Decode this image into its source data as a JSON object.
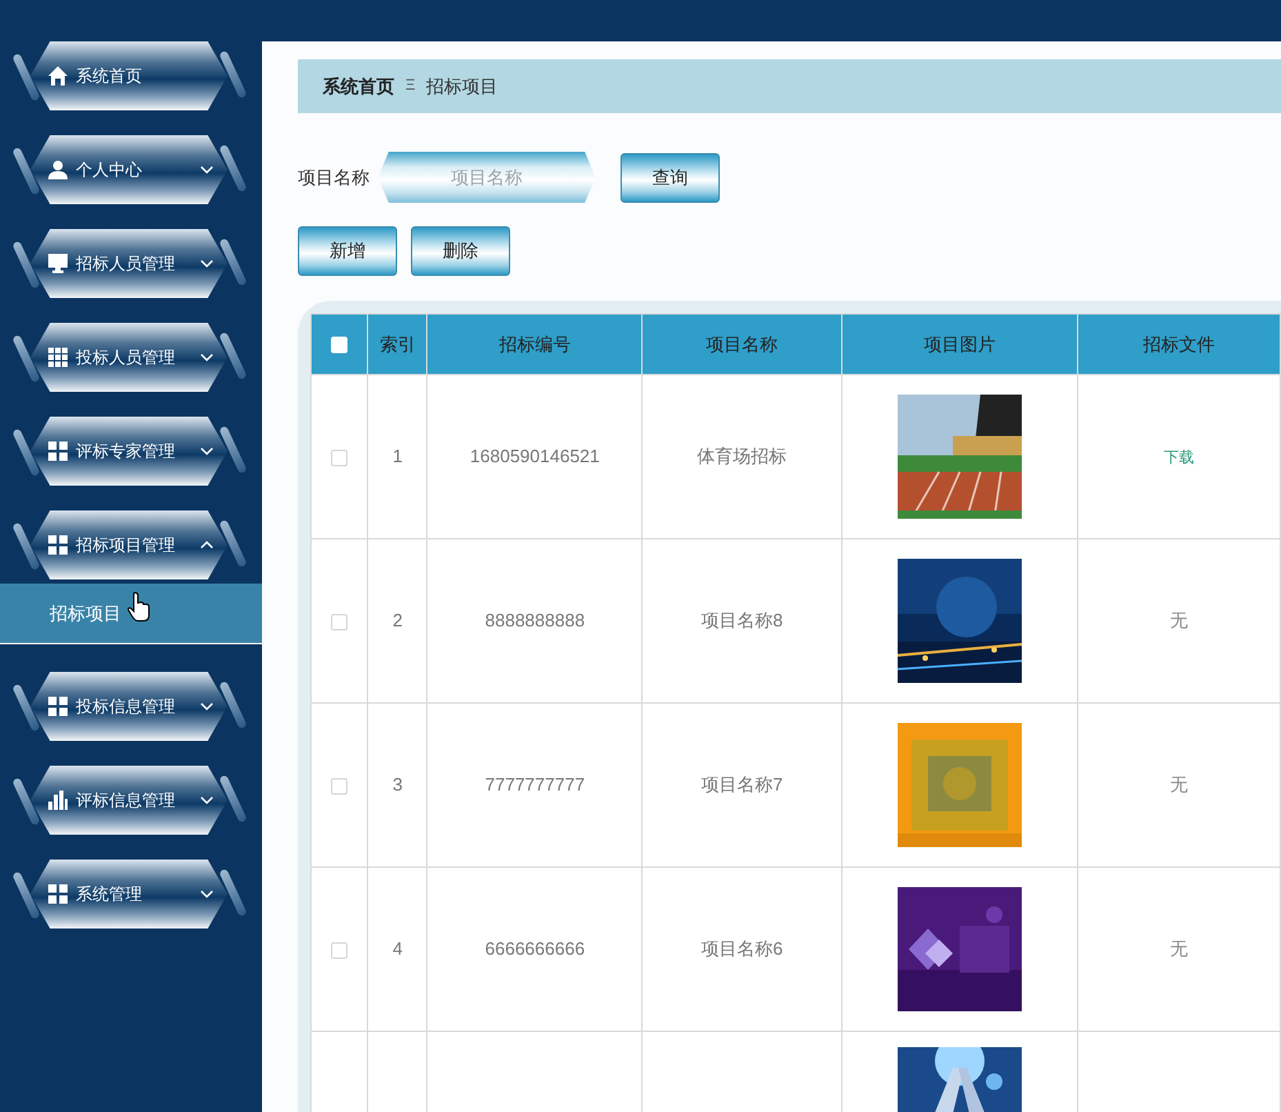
{
  "sidebar": {
    "items": [
      {
        "label": "系统首页",
        "kind": "link"
      },
      {
        "label": "个人中心",
        "kind": "menu",
        "expanded": false
      },
      {
        "label": "招标人员管理",
        "kind": "menu",
        "expanded": false
      },
      {
        "label": "投标人员管理",
        "kind": "menu",
        "expanded": false
      },
      {
        "label": "评标专家管理",
        "kind": "menu",
        "expanded": false
      },
      {
        "label": "招标项目管理",
        "kind": "menu",
        "expanded": true,
        "children": [
          {
            "label": "招标项目",
            "selected": true
          }
        ]
      },
      {
        "label": "投标信息管理",
        "kind": "menu",
        "expanded": false
      },
      {
        "label": "评标信息管理",
        "kind": "menu",
        "expanded": false
      },
      {
        "label": "系统管理",
        "kind": "menu",
        "expanded": false
      }
    ]
  },
  "breadcrumb": {
    "home": "系统首页",
    "separator": "Ξ",
    "current": "招标项目"
  },
  "search": {
    "label": "项目名称",
    "placeholder": "项目名称",
    "button": "查询"
  },
  "actions": [
    "新增",
    "删除"
  ],
  "table": {
    "select_all_checked": false,
    "columns": [
      "索引",
      "招标编号",
      "项目名称",
      "项目图片",
      "招标文件"
    ],
    "rows": [
      {
        "kind": "full",
        "checked": false,
        "index": "1",
        "number": "1680590146521",
        "name": "体育场招标",
        "file": {
          "text": "下载",
          "kind": "link"
        }
      },
      {
        "kind": "full",
        "checked": false,
        "index": "2",
        "number": "8888888888",
        "name": "项目名称8",
        "file": {
          "text": "无",
          "kind": "plain"
        }
      },
      {
        "kind": "full",
        "checked": false,
        "index": "3",
        "number": "7777777777",
        "name": "项目名称7",
        "file": {
          "text": "无",
          "kind": "plain"
        }
      },
      {
        "kind": "full",
        "checked": false,
        "index": "4",
        "number": "6666666666",
        "name": "项目名称6",
        "file": {
          "text": "无",
          "kind": "plain"
        }
      },
      {
        "kind": "cut"
      }
    ]
  }
}
